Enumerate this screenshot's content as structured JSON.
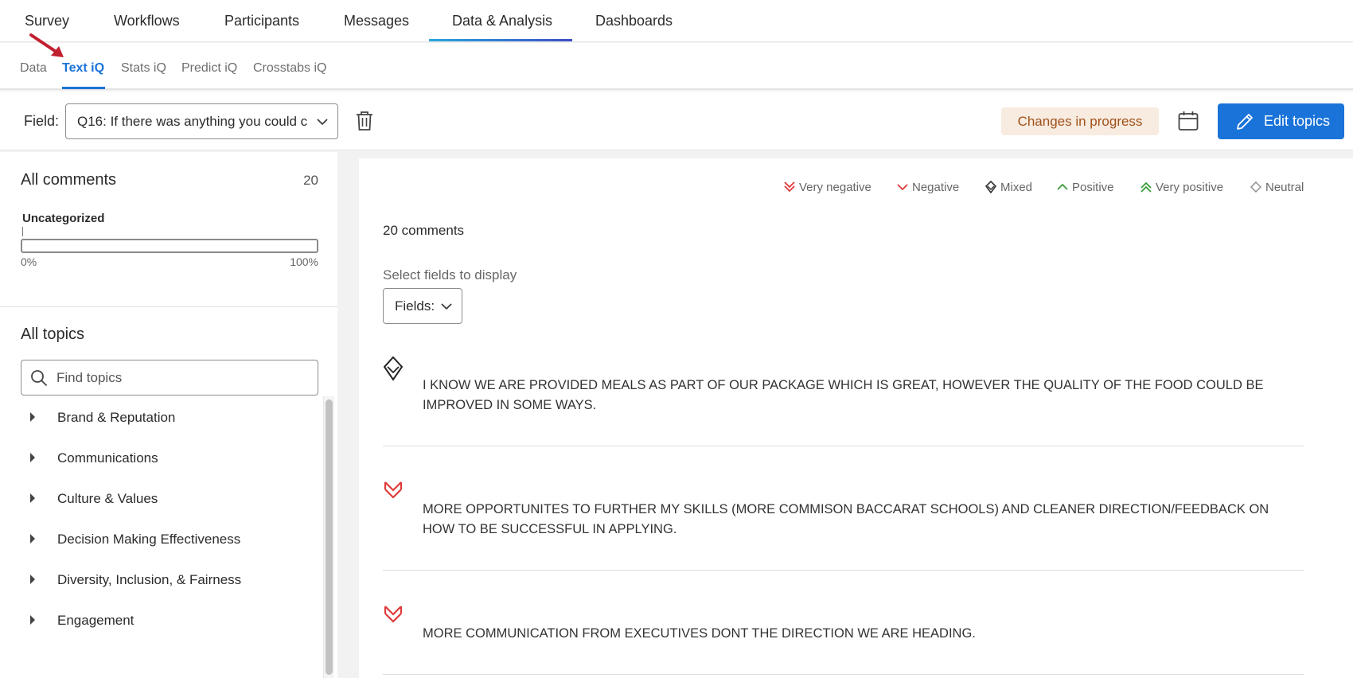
{
  "top_nav": {
    "items": [
      "Survey",
      "Workflows",
      "Participants",
      "Messages",
      "Data & Analysis",
      "Dashboards"
    ],
    "active": "Data & Analysis"
  },
  "sub_nav": {
    "items": [
      "Data",
      "Text iQ",
      "Stats iQ",
      "Predict iQ",
      "Crosstabs iQ"
    ],
    "active": "Text iQ"
  },
  "toolbar": {
    "field_label": "Field:",
    "field_value": "Q16: If there was anything you could c",
    "status_badge": "Changes in progress",
    "edit_button": "Edit topics"
  },
  "left_panel": {
    "all_comments_label": "All comments",
    "all_comments_count": "20",
    "uncategorized_label": "Uncategorized",
    "uncategorized_percent": 0,
    "min_label": "0%",
    "max_label": "100%",
    "all_topics_label": "All topics",
    "search_placeholder": "Find topics",
    "topics": [
      "Brand & Reputation",
      "Communications",
      "Culture & Values",
      "Decision Making Effectiveness",
      "Diversity, Inclusion, & Fairness",
      "Engagement"
    ]
  },
  "legend": [
    {
      "label": "Very negative",
      "icon": "very-negative-icon",
      "color": "#e03a3a"
    },
    {
      "label": "Negative",
      "icon": "negative-icon",
      "color": "#e03a3a"
    },
    {
      "label": "Mixed",
      "icon": "mixed-icon",
      "color": "#333333"
    },
    {
      "label": "Positive",
      "icon": "positive-icon",
      "color": "#3b9d3b"
    },
    {
      "label": "Very positive",
      "icon": "very-positive-icon",
      "color": "#3b9d3b"
    },
    {
      "label": "Neutral",
      "icon": "neutral-icon",
      "color": "#8a8a8a"
    }
  ],
  "main": {
    "comment_count": "20 comments",
    "select_fields_label": "Select fields to display",
    "fields_button": "Fields:",
    "comments": [
      {
        "sentiment": "mixed",
        "line1": "I KNOW WE ARE PROVIDED MEALS AS PART OF OUR PACKAGE WHICH IS GREAT, HOWEVER THE QUALITY OF THE FOOD COULD BE",
        "line2": "IMPROVED IN SOME WAYS."
      },
      {
        "sentiment": "very-negative",
        "line1": "MORE OPPORTUNITES TO FURTHER MY SKILLS (MORE COMMISON BACCARAT SCHOOLS) AND CLEANER DIRECTION/FEEDBACK ON",
        "line2": "HOW TO BE SUCCESSFUL IN APPLYING."
      },
      {
        "sentiment": "very-negative",
        "line1": "MORE COMMUNICATION FROM EXECUTIVES DONT THE DIRECTION WE ARE HEADING.",
        "line2": ""
      }
    ]
  },
  "colors": {
    "accent": "#1a73d9",
    "badge_bg": "#f8ebe0",
    "badge_text": "#a0521b",
    "annotation_arrow": "#c0202f"
  }
}
